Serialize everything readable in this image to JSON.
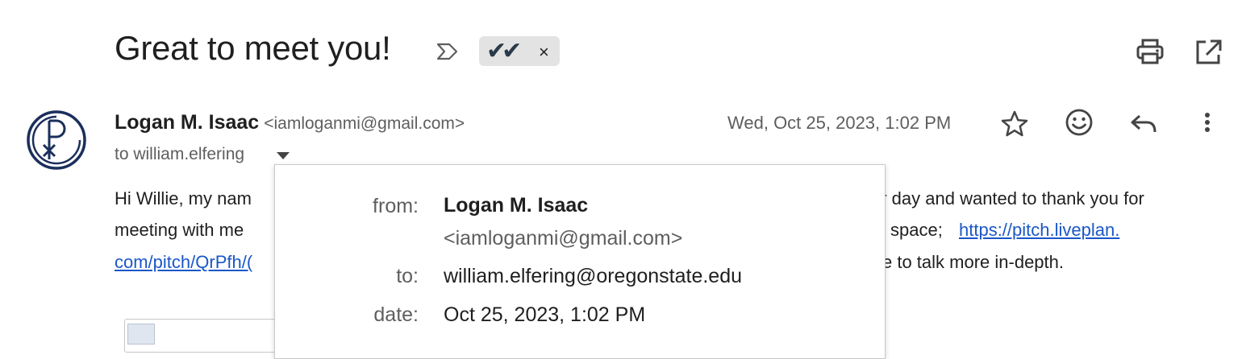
{
  "message": {
    "subject": "Great to meet you!",
    "label_chip": {
      "text": "✔✔",
      "close": "×"
    },
    "sender": {
      "name": "Logan M. Isaac",
      "email": "<iamloganmi@gmail.com>"
    },
    "date": "Wed, Oct 25, 2023, 1:02 PM",
    "to_line": "to william.elfering",
    "body": {
      "line1_left": "Hi Willie, my nam",
      "line1_right": "er day and wanted to thank you for",
      "line2_left": "meeting with me",
      "line2_mid": "space;",
      "line2_link": "https://pitch.liveplan.",
      "line3_link": "com/pitch/QrPfh/(",
      "line3_right": "e to talk more in-depth."
    }
  },
  "details_popup": {
    "from_label": "from:",
    "from_name": "Logan M. Isaac",
    "from_email": "<iamloganmi@gmail.com>",
    "to_label": "to:",
    "to_value": "william.elfering@oregonstate.edu",
    "date_label": "date:",
    "date_value": "Oct 25, 2023, 1:02 PM"
  },
  "icons": {
    "important": "importance-marker-icon",
    "print": "print-icon",
    "popout": "open-in-new-window-icon",
    "star": "star-icon",
    "emoji": "emoji-reaction-icon",
    "reply": "reply-icon",
    "more": "more-vert-icon",
    "caret": "show-details-caret-icon",
    "avatar": "chi-rho-avatar"
  },
  "colors": {
    "link": "#1a57c8",
    "secondary_text": "#5e5e5e",
    "avatar": "#1b2f5c",
    "chip_bg": "#e3e3e3"
  }
}
